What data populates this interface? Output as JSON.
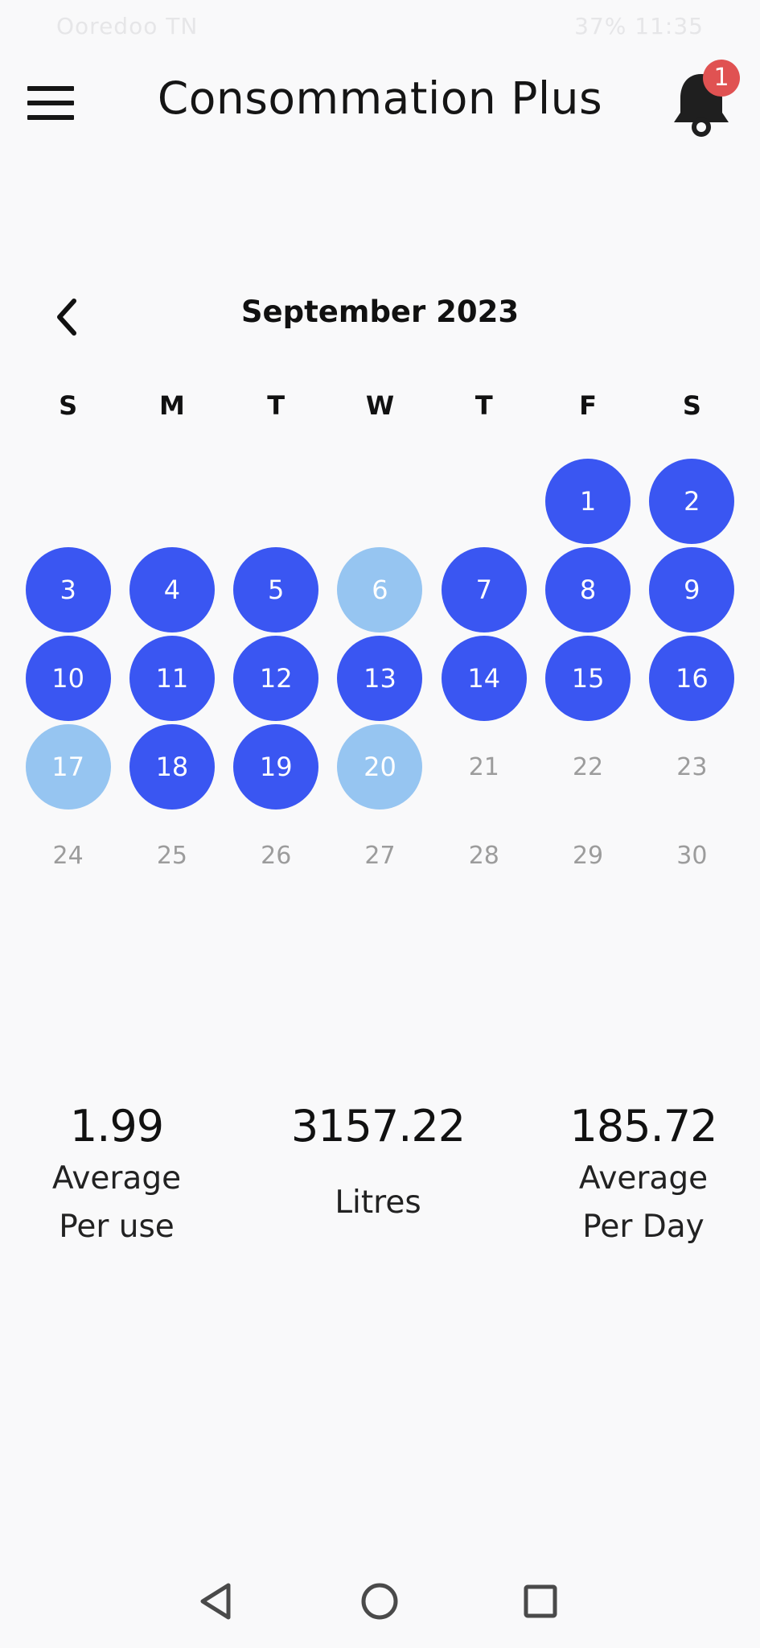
{
  "status_bar": {
    "left_text": "Ooredoo TN",
    "right_text": "37% 11:35"
  },
  "header": {
    "title": "Consommation Plus",
    "notification_count": "1"
  },
  "calendar": {
    "month_label": "September 2023",
    "weekdays": [
      "S",
      "M",
      "T",
      "W",
      "T",
      "F",
      "S"
    ],
    "days": [
      {
        "label": "",
        "state": "empty"
      },
      {
        "label": "",
        "state": "empty"
      },
      {
        "label": "",
        "state": "empty"
      },
      {
        "label": "",
        "state": "empty"
      },
      {
        "label": "",
        "state": "empty"
      },
      {
        "label": "1",
        "state": "active"
      },
      {
        "label": "2",
        "state": "active"
      },
      {
        "label": "3",
        "state": "active"
      },
      {
        "label": "4",
        "state": "active"
      },
      {
        "label": "5",
        "state": "active"
      },
      {
        "label": "6",
        "state": "light"
      },
      {
        "label": "7",
        "state": "active"
      },
      {
        "label": "8",
        "state": "active"
      },
      {
        "label": "9",
        "state": "active"
      },
      {
        "label": "10",
        "state": "active"
      },
      {
        "label": "11",
        "state": "active"
      },
      {
        "label": "12",
        "state": "active"
      },
      {
        "label": "13",
        "state": "active"
      },
      {
        "label": "14",
        "state": "active"
      },
      {
        "label": "15",
        "state": "active"
      },
      {
        "label": "16",
        "state": "active"
      },
      {
        "label": "17",
        "state": "light"
      },
      {
        "label": "18",
        "state": "active"
      },
      {
        "label": "19",
        "state": "active"
      },
      {
        "label": "20",
        "state": "light"
      },
      {
        "label": "21",
        "state": "future"
      },
      {
        "label": "22",
        "state": "future"
      },
      {
        "label": "23",
        "state": "future"
      },
      {
        "label": "24",
        "state": "future"
      },
      {
        "label": "25",
        "state": "future"
      },
      {
        "label": "26",
        "state": "future"
      },
      {
        "label": "27",
        "state": "future"
      },
      {
        "label": "28",
        "state": "future"
      },
      {
        "label": "29",
        "state": "future"
      },
      {
        "label": "30",
        "state": "future"
      }
    ],
    "colors": {
      "active": "#3a56f2",
      "light": "#96c5f1",
      "future_text": "#9c9c9c"
    }
  },
  "stats": {
    "per_use": {
      "value": "1.99",
      "line1": "Average",
      "line2": "Per use"
    },
    "total": {
      "value": "3157.22",
      "label": "Litres"
    },
    "per_day": {
      "value": "185.72",
      "line1": "Average",
      "line2": "Per Day"
    }
  },
  "nav_bar": {
    "icons": [
      "back-triangle-icon",
      "home-circle-icon",
      "recents-square-icon"
    ]
  }
}
